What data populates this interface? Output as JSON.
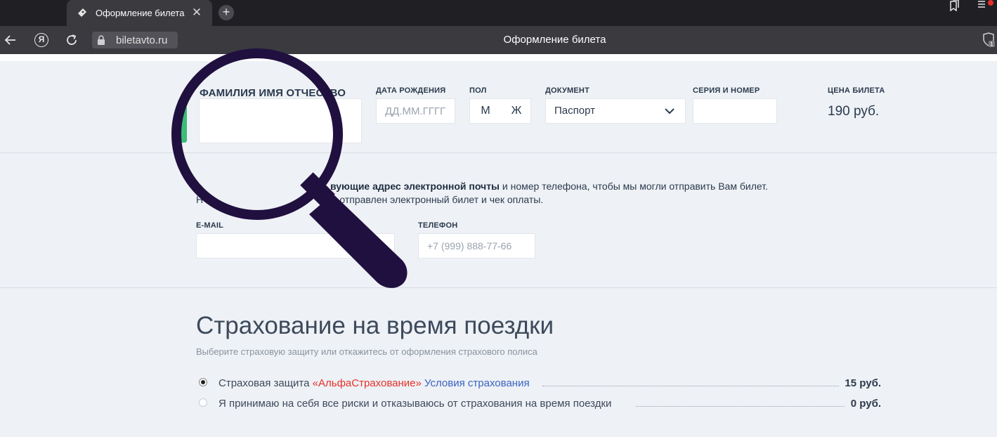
{
  "browser": {
    "tab": {
      "title": "Оформление билета",
      "close": "✕"
    },
    "new_tab": "+",
    "url": "biletavto.ru",
    "page_title": "Оформление билета"
  },
  "passenger": {
    "full_name_label": "ФАМИЛИЯ ИМЯ ОТЧЕСТВО",
    "full_name_value": "",
    "birth_label": "ДАТА РОЖДЕНИЯ",
    "birth_placeholder": "ДД.ММ.ГГГГ",
    "gender_label": "ПОЛ",
    "gender_options": [
      "М",
      "Ж"
    ],
    "document_label": "ДОКУМЕНТ",
    "document_value": "Паспорт",
    "series_label": "СЕРИЯ И НОМЕР",
    "series_value": "",
    "price_label": "ЦЕНА БИЛЕТА",
    "price_value": "190 руб."
  },
  "contacts": {
    "line1_bold": "вующие адрес электронной почты",
    "line1_rest": " и номер телефона, чтобы мы могли отправить Вам билет.",
    "line2_start": "Н",
    "line2_rest": "уде отправлен электронный билет и чек оплаты.",
    "email_label": "E-MAIL",
    "email_value": "",
    "phone_label": "ТЕЛЕФОН",
    "phone_placeholder": "+7 (999) 888-77-66"
  },
  "insurance": {
    "title": "Страхование на время поездки",
    "subtitle": "Выберите страховую защиту или откажитесь от оформления страхового полиса",
    "option1": {
      "prefix": "Страховая защита ",
      "company": "«АльфаСтрахование»",
      "link": "Условия страхования",
      "price": "15 руб.",
      "selected": true
    },
    "option2": {
      "text": "Я принимаю на себя все риски и отказываюсь от страхования на время поездки",
      "price": "0 руб.",
      "selected": false
    }
  },
  "colors": {
    "accent_green": "#3dbd78",
    "link_blue": "#3a63c4",
    "brand_red": "#e5312b",
    "magnifier": "#20103f"
  }
}
